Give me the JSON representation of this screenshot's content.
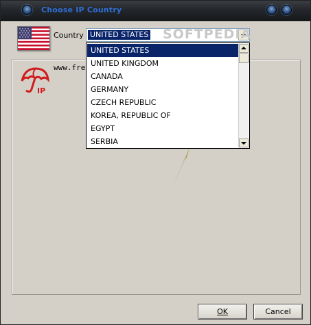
{
  "window": {
    "title": "Choose IP Country"
  },
  "country": {
    "label": "Country",
    "selected": "UNITED STATES",
    "options": [
      "UNITED STATES",
      "UNITED KINGDOM",
      "CANADA",
      "GERMANY",
      "CZECH REPUBLIC",
      "KOREA, REPUBLIC OF",
      "EGYPT",
      "SERBIA"
    ]
  },
  "watermark": "SOFTPEDIA",
  "panel": {
    "site_text": "www.free",
    "logo_text": "IP"
  },
  "buttons": {
    "ok_label": "OK",
    "cancel_label": "Cancel"
  },
  "colors": {
    "title_text": "#2f6fd6",
    "selection": "#0a246a",
    "logo_red": "#d01c1c",
    "dialog_bg": "#d4d0c8"
  },
  "icons": {
    "flag": "us-flag-icon",
    "logo": "umbrella-ip-logo-icon",
    "orbs": "window-orb-icon",
    "dropdown_arrow": "chevron-down-icon"
  }
}
